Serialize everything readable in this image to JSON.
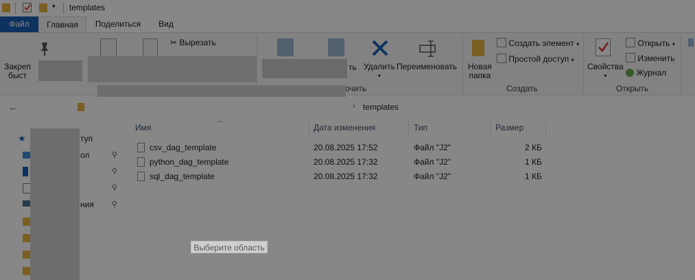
{
  "window": {
    "title": "templates"
  },
  "tabs": [
    {
      "label": "Файл"
    },
    {
      "label": "Главная"
    },
    {
      "label": "Поделиться"
    },
    {
      "label": "Вид"
    }
  ],
  "ribbon": {
    "pin": {
      "label_line1": "Закреп",
      "label_line2": "быст"
    },
    "cut_label": "Вырезать",
    "organize_group": "рядочить",
    "move_partial": "ть",
    "delete_label": "Удалить",
    "rename_label": "Переименовать",
    "new_folder_line1": "Новая",
    "new_folder_line2": "папка",
    "create_item_label": "Создать элемент",
    "easy_access_label": "Простой доступ",
    "create_group": "Создать",
    "properties_label": "Свойства",
    "open_label": "Открыть",
    "edit_label": "Изменить",
    "history_label": "Журнал",
    "open_group": "Открыть"
  },
  "address": {
    "current": "templates"
  },
  "columns": {
    "name": "Имя",
    "date": "Дата изменения",
    "type": "Тип",
    "size": "Размер"
  },
  "files": [
    {
      "name": "csv_dag_template",
      "date": "20.08.2025 17:52",
      "type": "Файл \"J2\"",
      "size": "2 КБ"
    },
    {
      "name": "python_dag_template",
      "date": "20.08.2025 17:32",
      "type": "Файл \"J2\"",
      "size": "1 КБ"
    },
    {
      "name": "sql_dag_template",
      "date": "20.08.2025 17:32",
      "type": "Файл \"J2\"",
      "size": "1 КБ"
    }
  ],
  "sidebar": {
    "quick_access_partial": "туп",
    "desktop_partial": "ол",
    "images_partial": "ния"
  },
  "overlay": {
    "hint": "Выберите область"
  },
  "colors": {
    "accent": "#1a5fb4",
    "folder": "#e8b341",
    "dim": "rgba(0,0,0,0.47)"
  }
}
